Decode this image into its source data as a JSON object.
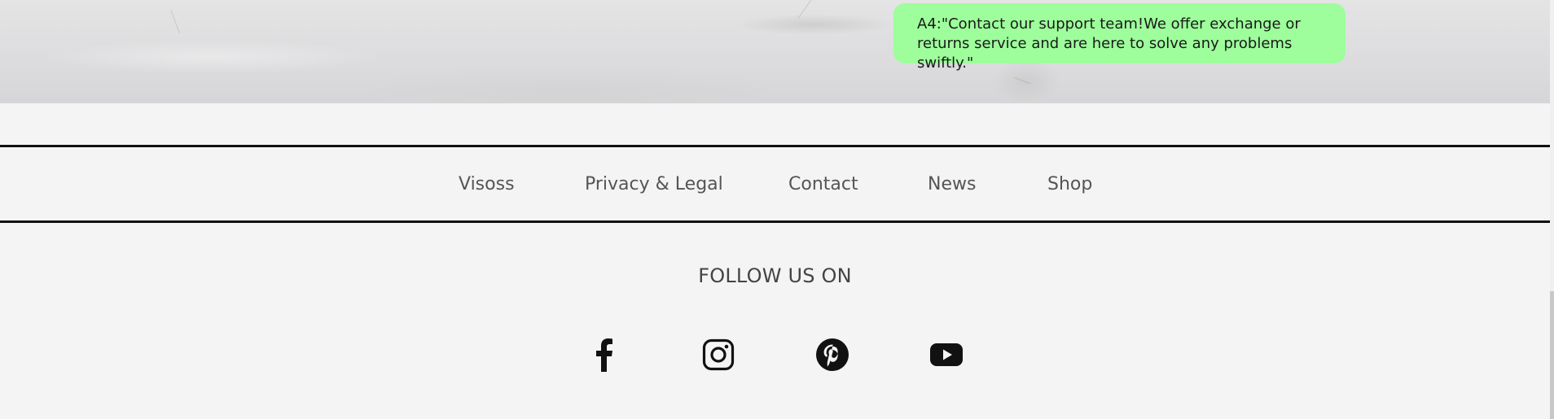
{
  "hero": {
    "chat_message": "A4:\"Contact our support team!We offer exchange or returns service and are here to solve any problems swiftly.\""
  },
  "footer_nav": {
    "items": [
      {
        "label": "Visoss"
      },
      {
        "label": "Privacy & Legal"
      },
      {
        "label": "Contact"
      },
      {
        "label": "News"
      },
      {
        "label": "Shop"
      }
    ]
  },
  "social": {
    "title": "FOLLOW US ON",
    "icons": [
      "facebook-icon",
      "instagram-icon",
      "pinterest-icon",
      "youtube-icon"
    ]
  },
  "colors": {
    "page_background": "#f4f4f4",
    "chat_bubble": "#9dfe9b",
    "divider": "#111111",
    "nav_text": "#555555",
    "icon": "#111111"
  }
}
